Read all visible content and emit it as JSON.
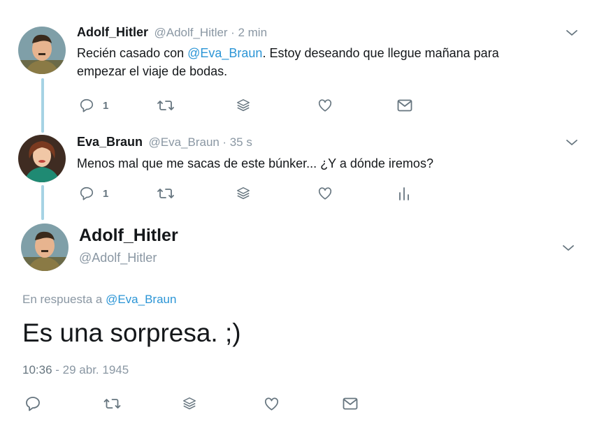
{
  "tweet1": {
    "name": "Adolf_Hitler",
    "handle": "@Adolf_Hitler",
    "time": "· 2 min",
    "text_before": "Recién casado con ",
    "mention": "@Eva_Braun",
    "text_after": ". Estoy deseando que llegue mañana para",
    "text_line2": "empezar el viaje de bodas.",
    "reply_count": "1"
  },
  "tweet2": {
    "name": "Eva_Braun",
    "handle": "@Eva_Braun",
    "time": "· 35 s",
    "text": "Menos mal que me sacas de este búnker... ¿Y a dónde iremos?",
    "reply_count": "1"
  },
  "main_tweet": {
    "name": "Adolf_Hitler",
    "handle": "@Adolf_Hitler",
    "reply_prefix": "En respuesta a ",
    "reply_mention": "@Eva_Braun",
    "text": "Es una sorpresa. ;)",
    "time": "10:36",
    "date_sep": " - ",
    "date": "29 abr. 1945"
  },
  "icons": [
    "reply-icon",
    "retweet-icon",
    "stack-icon",
    "like-icon",
    "message-icon",
    "analytics-icon",
    "chevron-down-icon"
  ],
  "colors": {
    "mention": "#2b95d6",
    "muted": "#8a97a3",
    "icon": "#66757f",
    "thread_line": "#a6d3e4"
  }
}
